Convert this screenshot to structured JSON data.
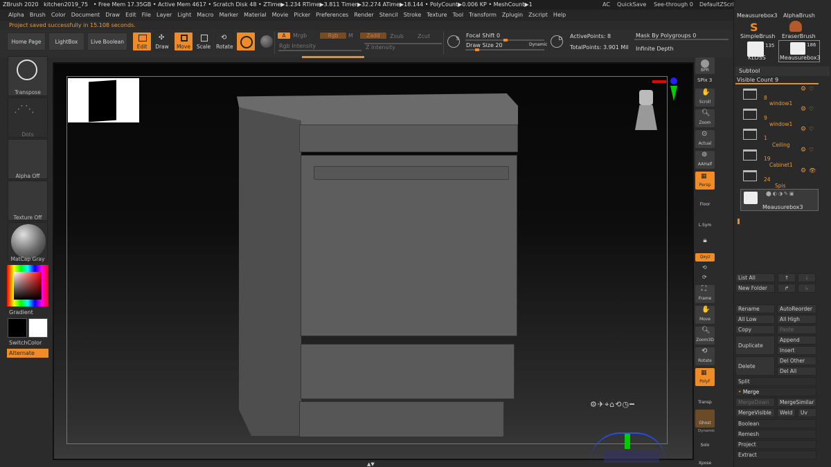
{
  "titlebar": {
    "app": "ZBrush 2020",
    "file": "kitchen2019_75",
    "stats": "• Free Mem 17.35GB • Active Mem 4617 • Scratch Disk 48 • ZTime▶1.234 RTime▶3.811 Timer▶32.274 ATime▶18.144 • PolyCount▶0.006 KP • MeshCount▶1",
    "ac": "AC",
    "quicksave": "QuickSave",
    "seethrough": "See-through  0",
    "zscript": "DefaultZScript"
  },
  "menu": [
    "Alpha",
    "Brush",
    "Color",
    "Document",
    "Draw",
    "Edit",
    "File",
    "Layer",
    "Light",
    "Macro",
    "Marker",
    "Material",
    "Movie",
    "Picker",
    "Preferences",
    "Render",
    "Stencil",
    "Stroke",
    "Texture",
    "Tool",
    "Transform",
    "Zplugin",
    "Zscript",
    "Help"
  ],
  "status": "Project saved successfully in 15.108 seconds.",
  "toolbar": {
    "home": "Home Page",
    "lightbox": "LightBox",
    "liveboolean": "Live Boolean",
    "edit": "Edit",
    "draw": "Draw",
    "move": "Move",
    "scale": "Scale",
    "rotate": "Rotate",
    "a": "A",
    "mrgb": "Mrgb",
    "rgb": "Rgb",
    "m": "M",
    "zadd": "Zadd",
    "zsub": "Zsub",
    "zcut": "Zcut",
    "rgbintensity": "Rgb Intensity",
    "zintensity": "Z Intensity",
    "focalshift": "Focal Shift 0",
    "drawsize": "Draw Size 20",
    "dynamic": "Dynamic",
    "activepoints": "ActivePoints: 8",
    "totalpoints": "TotalPoints: 3.901 Mil",
    "maskpoly": "Mask By Polygroups 0",
    "infinitedepth": "Infinite Depth",
    "s": "S",
    "d": "D"
  },
  "left": {
    "transpose": "Transpose",
    "dots": "Dots",
    "alphaoff": "Alpha Off",
    "textureoff": "Texture Off",
    "matcap": "MatCap Gray",
    "gradient": "Gradient",
    "switchcolor": "SwitchColor",
    "alternate": "Alternate"
  },
  "rightstrip": [
    "BPR",
    "SPix 3",
    "Scroll",
    "Zoom",
    "Actual",
    "AAHalf",
    "Persp",
    "Floor",
    "L.Sym",
    "Qxyz",
    "",
    "",
    "Frame",
    "Move",
    "Zoom3D",
    "Rotate",
    "PolyF",
    "Transp",
    "Ghost",
    "Dynamic",
    "Solo",
    "Xpose"
  ],
  "brushes": {
    "meausurebox3": "Meausurebox3",
    "alphabrush": "AlphaBrush",
    "simplebrush": "SimpleBrush",
    "eraserbrush": "EraserBrush",
    "kloss": "KLOSS",
    "kloss_count": "135",
    "meausurebox3b": "Meausurebox3",
    "mb_count": "186"
  },
  "subtool": {
    "header": "Subtool",
    "visiblecount": "Visible Count 9",
    "items": [
      {
        "num": "8",
        "name": "window1"
      },
      {
        "num": "9",
        "name": "window1"
      },
      {
        "num": "1",
        "name": "Ceiling"
      },
      {
        "num": "19",
        "name": "Cabinet1"
      },
      {
        "num": "24",
        "name": "Spis"
      }
    ],
    "selected": "Meausurebox3"
  },
  "subtool_buttons": {
    "listall": "List All",
    "newfolder": "New Folder",
    "rename": "Rename",
    "autoreorder": "AutoReorder",
    "alllow": "All Low",
    "allhigh": "All High",
    "copy": "Copy",
    "paste": "Paste",
    "duplicate": "Duplicate",
    "append": "Append",
    "insert": "Insert",
    "delete": "Delete",
    "delother": "Del Other",
    "delall": "Del All",
    "split": "Split",
    "merge": "Merge",
    "mergedown": "MergeDown",
    "mergesimilar": "MergeSimilar",
    "mergevisible": "MergeVisible",
    "weld": "Weld",
    "uv": "Uv",
    "boolean": "Boolean",
    "remesh": "Remesh",
    "project": "Project",
    "extract": "Extract"
  },
  "colors": {
    "accent": "#f08c28",
    "bg": "#2b2b2b"
  }
}
